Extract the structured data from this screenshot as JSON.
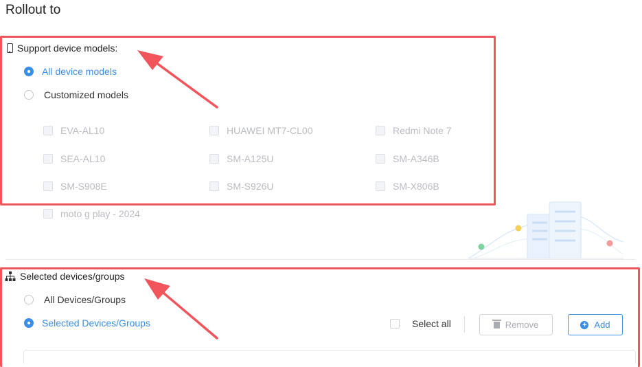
{
  "page": {
    "title": "Rollout to"
  },
  "device_models": {
    "heading": "Support device models:",
    "options": [
      {
        "label": "All device models",
        "selected": true
      },
      {
        "label": "Customized models",
        "selected": false
      }
    ],
    "models": [
      "EVA-AL10",
      "HUAWEI MT7-CL00",
      "Redmi Note 7",
      "SEA-AL10",
      "SM-A125U",
      "SM-A346B",
      "SM-S908E",
      "SM-S926U",
      "SM-X806B",
      "moto g play - 2024"
    ]
  },
  "devices_groups": {
    "heading": "Selected devices/groups",
    "options": [
      {
        "label": "All Devices/Groups",
        "selected": false
      },
      {
        "label": "Selected Devices/Groups",
        "selected": true
      }
    ],
    "select_all_label": "Select all",
    "remove_label": "Remove",
    "add_label": "Add"
  },
  "colors": {
    "accent": "#3a8ee6",
    "highlight_box": "#f1545b",
    "disabled_text": "#b9bcc2"
  },
  "icons": {
    "device_models": "phone-icon",
    "devices_groups": "org-chart-icon",
    "remove": "trash-icon",
    "add": "plus-circle-icon"
  }
}
